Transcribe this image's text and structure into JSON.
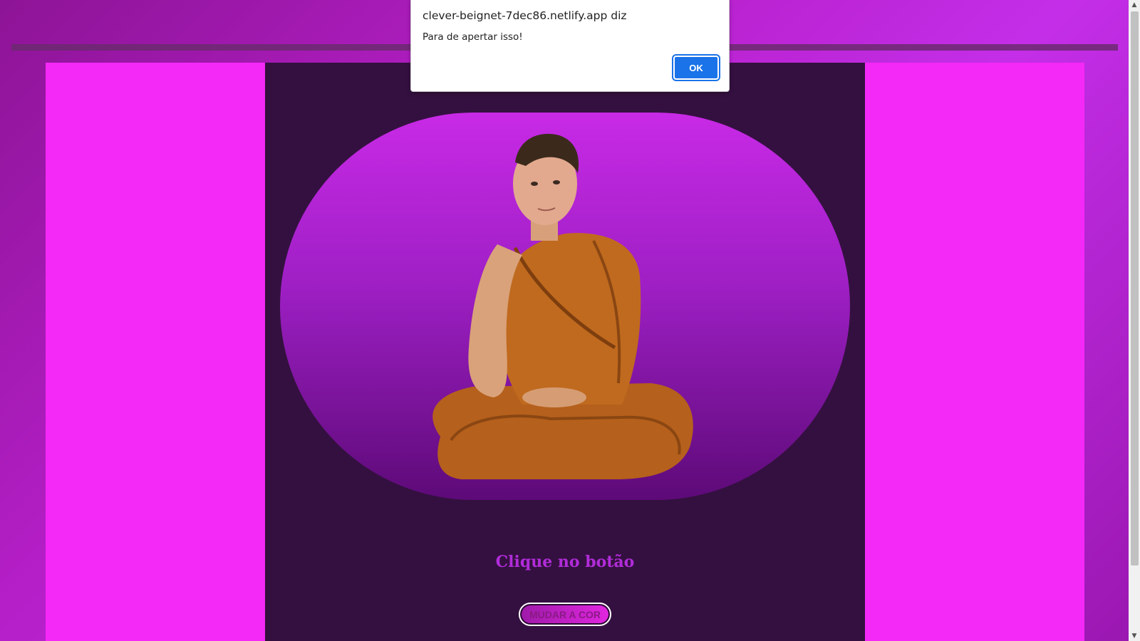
{
  "alert": {
    "title": "clever-beignet-7dec86.netlify.app diz",
    "message": "Para de apertar isso!",
    "ok_label": "OK"
  },
  "main": {
    "heading": "Clique no botão",
    "button_label": "MUDAR A COR",
    "portrait_alt": "person-in-orange-monk-robe"
  },
  "colors": {
    "page_gradient": [
      "#8d1496",
      "#c42ee8"
    ],
    "side_panels": "#f428f7",
    "center_panel": "#341040",
    "heading": "#b12cd9",
    "alert_ok": "#1a73e8"
  }
}
